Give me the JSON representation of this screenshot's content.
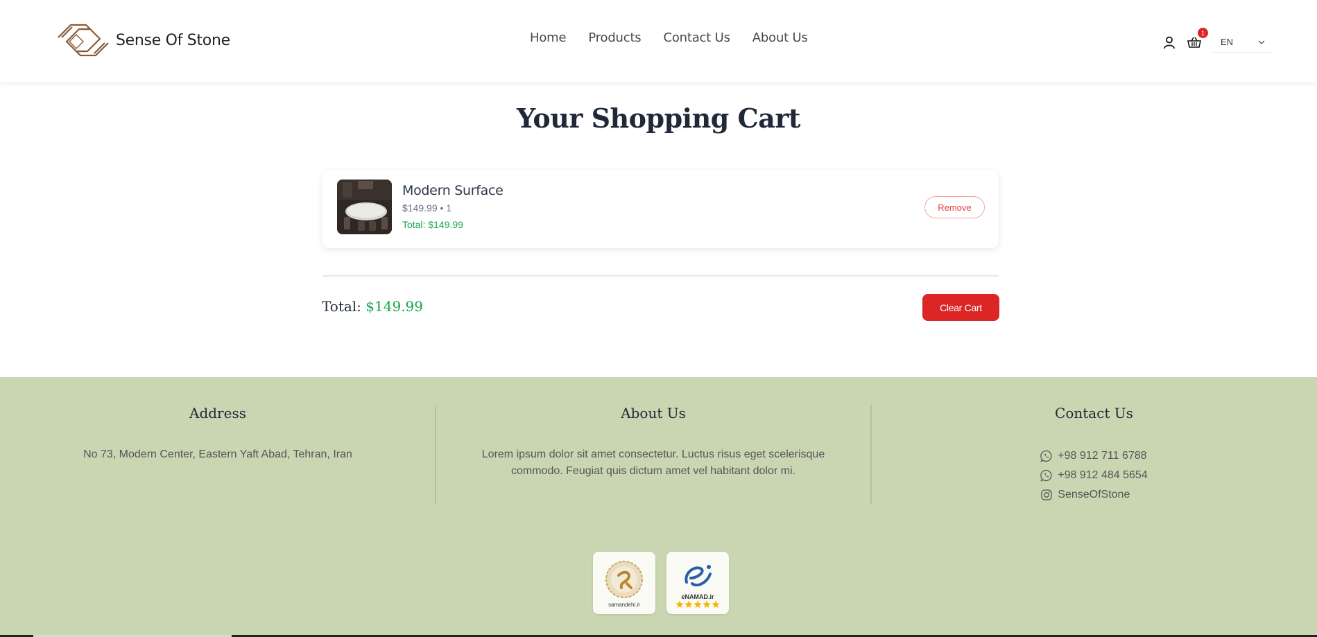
{
  "header": {
    "brand": "Sense Of Stone",
    "nav": [
      "Home",
      "Products",
      "Contact Us",
      "About Us"
    ],
    "cart_count": "1",
    "language": "EN"
  },
  "main": {
    "title": "Your Shopping Cart",
    "items": [
      {
        "name": "Modern Surface",
        "price_line": "$149.99 • 1",
        "total_line": "Total: $149.99",
        "remove_label": "Remove"
      }
    ],
    "total_label": "Total:",
    "total_value": "$149.99",
    "clear_label": "Clear Cart"
  },
  "footer": {
    "address": {
      "heading": "Address",
      "text": "No 73, Modern Center, Eastern Yaft Abad, Tehran, Iran"
    },
    "about": {
      "heading": "About Us",
      "text": "Lorem ipsum dolor sit amet consectetur. Luctus risus eget scelerisque commodo. Feugiat quis dictum amet vel habitant dolor mi."
    },
    "contact": {
      "heading": "Contact Us",
      "phone1": "+98 912 711 6788",
      "phone2": "+98 912 484 5654",
      "instagram": "SenseOfStone"
    },
    "badges": {
      "samandehi_caption": "samandehi.ir",
      "enamad_caption": "eNAMAD.ir"
    }
  },
  "colors": {
    "accent_green": "#16a34a",
    "danger_red": "#dc2626",
    "footer_bg": "#cad6b2",
    "logo_brown": "#8b5a34"
  }
}
